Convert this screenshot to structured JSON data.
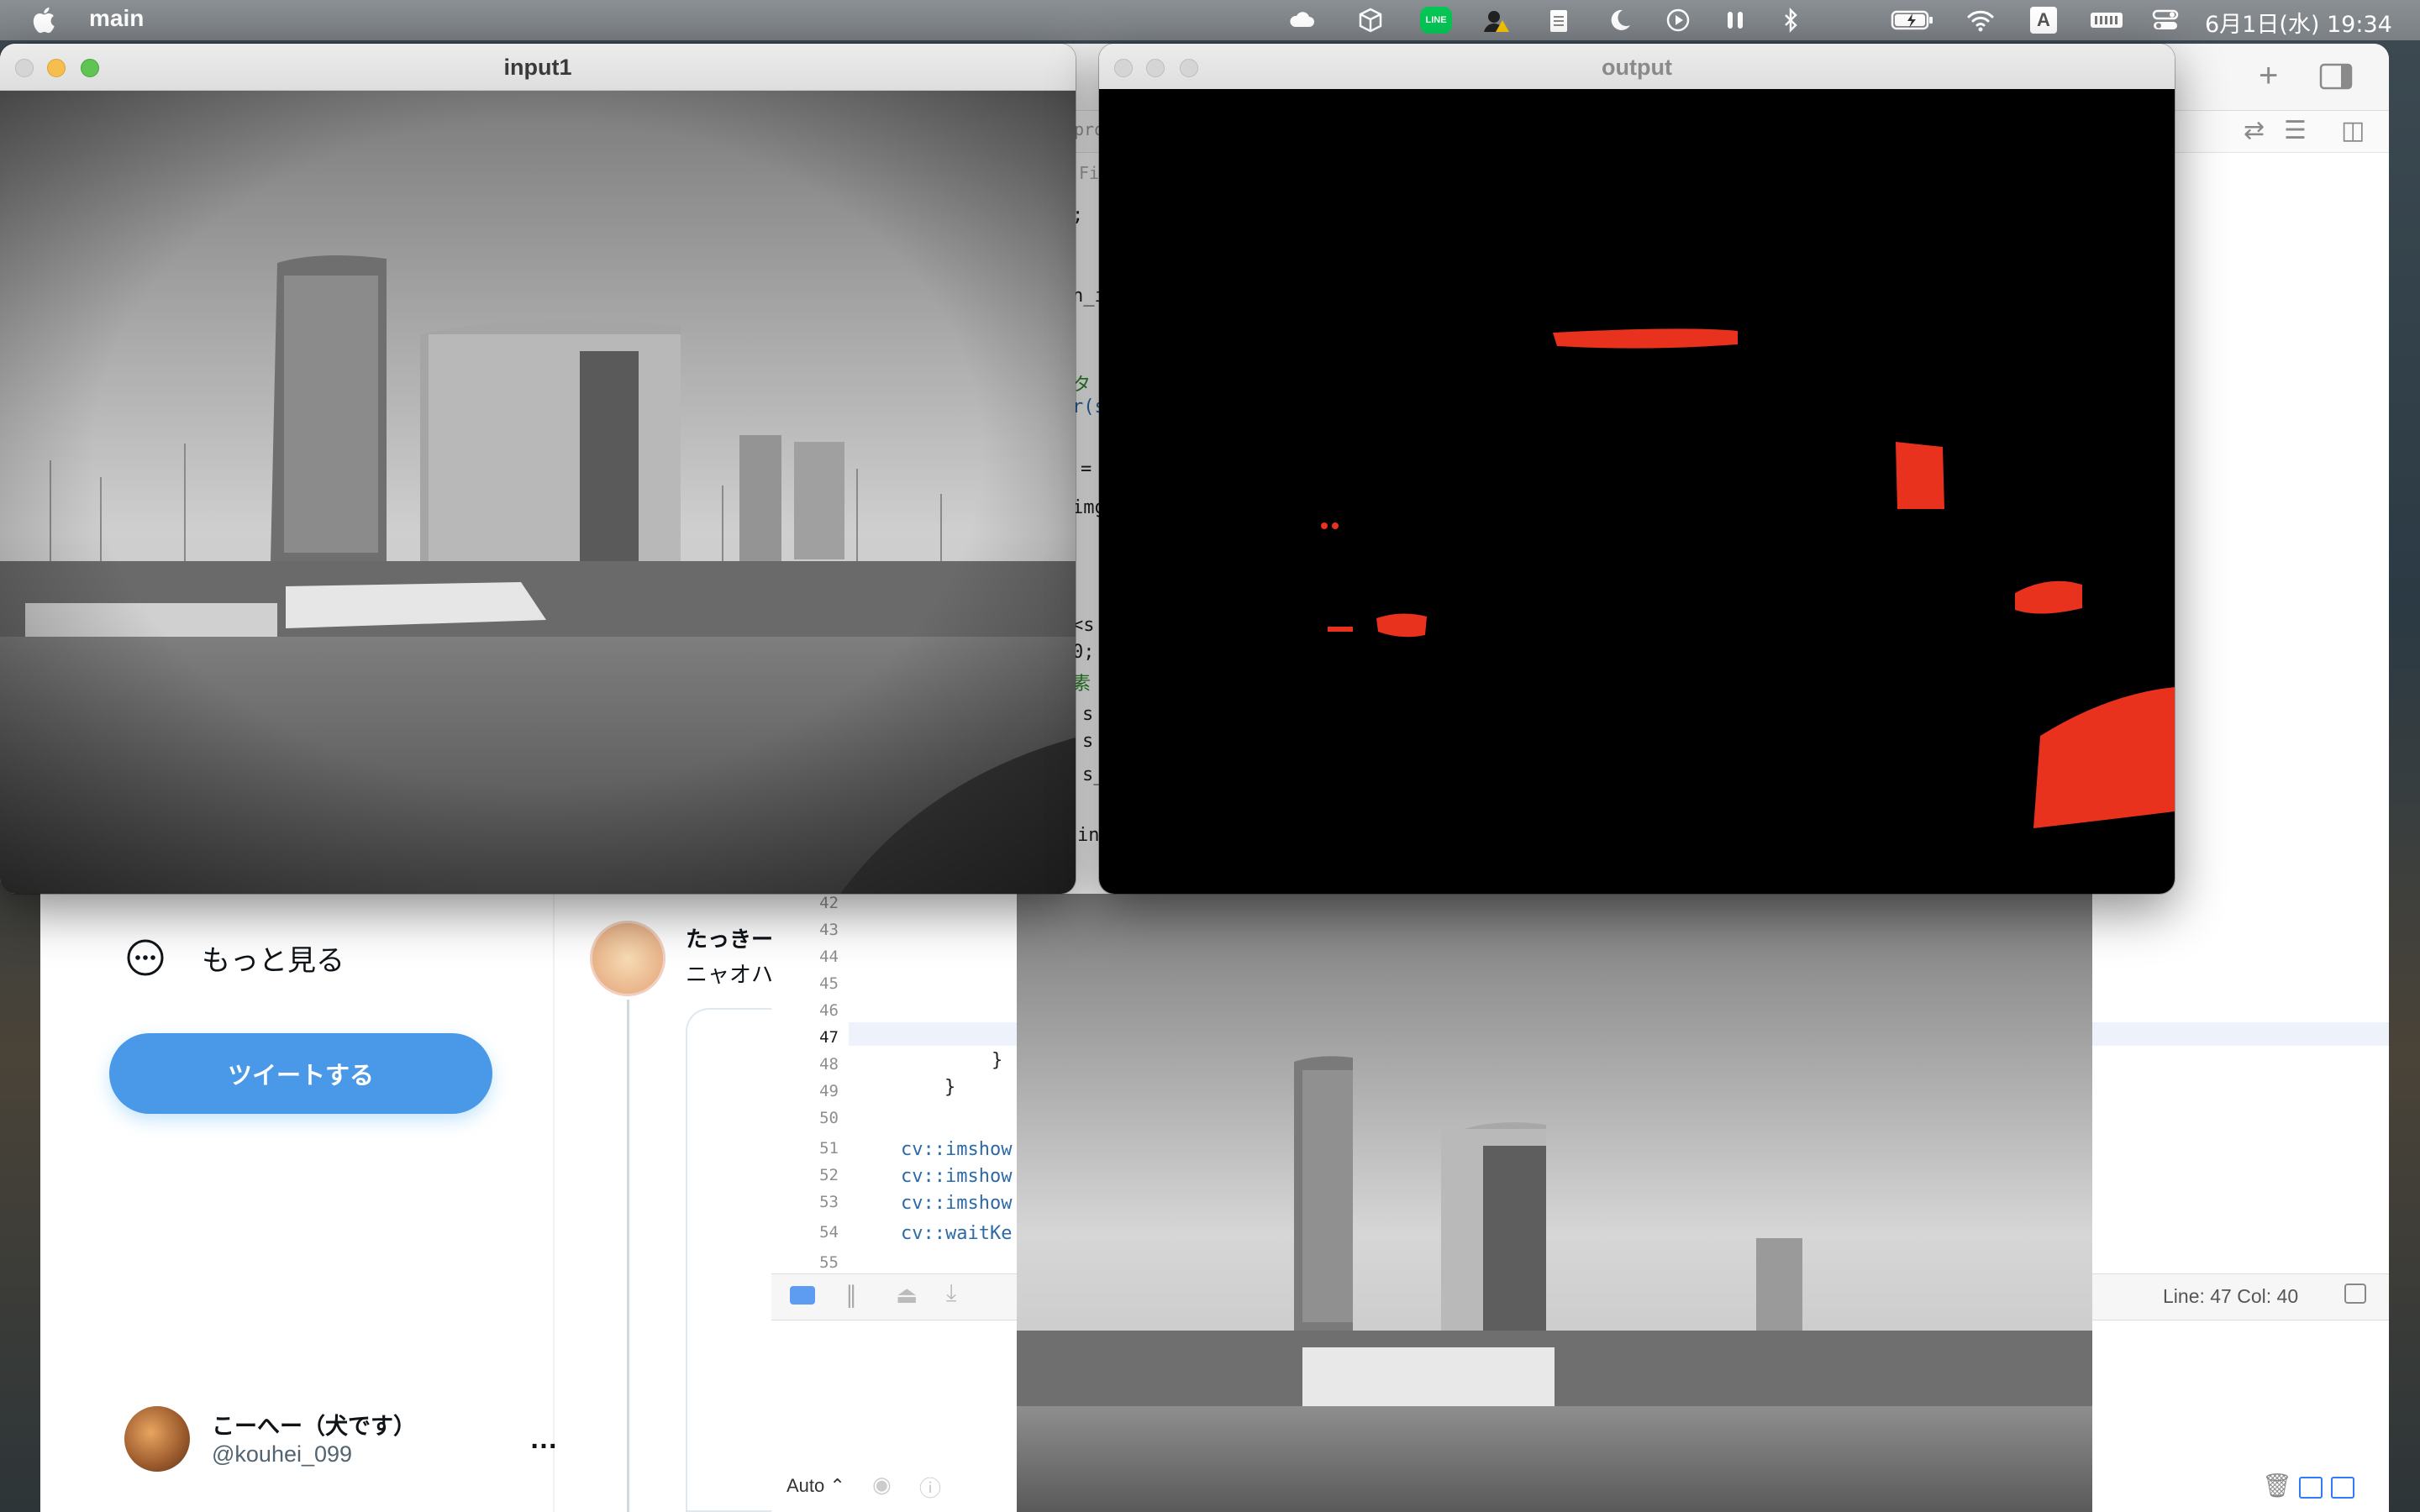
{
  "menubar": {
    "app_name": "main",
    "clock": "6月1日(水) 19:34",
    "icons": [
      "apple-icon",
      "icloud-icon",
      "package-icon",
      "line-app-icon",
      "user-warning-icon",
      "clipboard-icon",
      "moon-icon",
      "play-icon",
      "airpods-icon",
      "bluetooth-icon",
      "battery-icon",
      "wifi-icon",
      "input-source-icon",
      "keyboard-icon",
      "control-center-icon"
    ],
    "line_badge": "LINE",
    "input_source": "A"
  },
  "windows": {
    "input1": {
      "title": "input1"
    },
    "output": {
      "title": "output"
    }
  },
  "twitter": {
    "more_label": "もっと見る",
    "tweet_button": "ツイートする",
    "profile_name": "こーへー（犬です）",
    "profile_handle": "@kouhei_099",
    "profile_more": "…",
    "feed_name": "たっきー",
    "feed_text": "ニャオハ立",
    "accent": "#4a99e9"
  },
  "xcode": {
    "line_numbers": [
      "42",
      "43",
      "44",
      "45",
      "46",
      "47",
      "48",
      "49",
      "50",
      "51",
      "52",
      "53",
      "54",
      "55"
    ],
    "current_line": "47",
    "code_lines": {
      "l48": "}",
      "l49": "}",
      "l51_ns": "cv",
      "l51_fn": "::imshow",
      "l52_ns": "cv",
      "l52_fn": "::imshow",
      "l53_ns": "cv",
      "l53_fn": "::imshow",
      "l54_ns": "cv",
      "l54_fn": "::waitKe"
    },
    "side_fragments": [
      ";",
      "n_i",
      "タ",
      "r(s",
      "=",
      "img",
      "<s",
      "0;",
      "素",
      "s",
      "s",
      "s_",
      "in",
      "pro",
      "Fi"
    ],
    "status": "Line: 47  Col: 40",
    "auto_select": "Auto"
  },
  "output_blobs_color": "#e8321e"
}
